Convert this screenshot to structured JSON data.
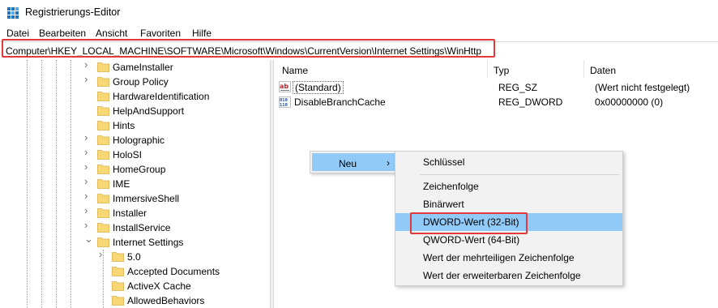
{
  "window": {
    "title": "Registrierungs-Editor"
  },
  "menubar": {
    "items": [
      "Datei",
      "Bearbeiten",
      "Ansicht",
      "Favoriten",
      "Hilfe"
    ]
  },
  "address": {
    "path": "Computer\\HKEY_LOCAL_MACHINE\\SOFTWARE\\Microsoft\\Windows\\CurrentVersion\\Internet Settings\\WinHttp"
  },
  "tree": {
    "items": [
      {
        "label": "GameInstaller",
        "expandable": true
      },
      {
        "label": "Group Policy",
        "expandable": true
      },
      {
        "label": "HardwareIdentification",
        "expandable": false
      },
      {
        "label": "HelpAndSupport",
        "expandable": false
      },
      {
        "label": "Hints",
        "expandable": false
      },
      {
        "label": "Holographic",
        "expandable": true
      },
      {
        "label": "HoloSI",
        "expandable": true
      },
      {
        "label": "HomeGroup",
        "expandable": true
      },
      {
        "label": "IME",
        "expandable": true
      },
      {
        "label": "ImmersiveShell",
        "expandable": true
      },
      {
        "label": "Installer",
        "expandable": true
      },
      {
        "label": "InstallService",
        "expandable": true
      },
      {
        "label": "Internet Settings",
        "expandable": true,
        "expanded": true
      },
      {
        "label": "5.0",
        "expandable": true,
        "child": true
      },
      {
        "label": "Accepted Documents",
        "expandable": false,
        "child": true
      },
      {
        "label": "ActiveX Cache",
        "expandable": false,
        "child": true
      },
      {
        "label": "AllowedBehaviors",
        "expandable": false,
        "child": true
      }
    ]
  },
  "list": {
    "columns": {
      "name": "Name",
      "type": "Typ",
      "data": "Daten"
    },
    "rows": [
      {
        "icon": "string-value-icon",
        "name": "(Standard)",
        "type": "REG_SZ",
        "data": "(Wert nicht festgelegt)"
      },
      {
        "icon": "binary-value-icon",
        "name": "DisableBranchCache",
        "type": "REG_DWORD",
        "data": "0x00000000 (0)"
      }
    ]
  },
  "context_menu": {
    "neu_label": "Neu",
    "submenu": [
      "Schlüssel",
      "Zeichenfolge",
      "Binärwert",
      "DWORD-Wert (32-Bit)",
      "QWORD-Wert (64-Bit)",
      "Wert der mehrteiligen Zeichenfolge",
      "Wert der erweiterbaren Zeichenfolge"
    ]
  },
  "colors": {
    "highlight": "#91c9f7",
    "annotation_red": "#e03a3a",
    "folder": "#f8d775"
  }
}
